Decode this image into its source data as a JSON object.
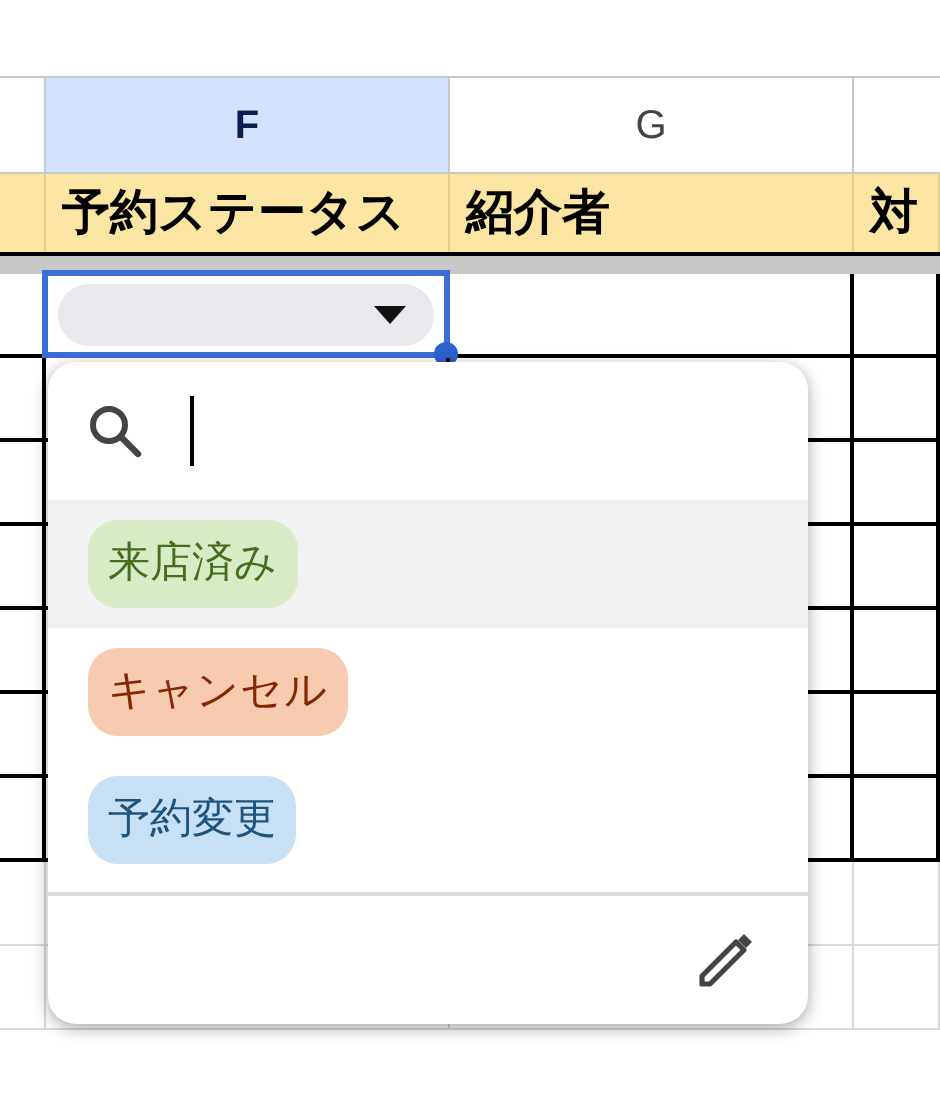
{
  "column_headers": [
    {
      "label": "F",
      "selected": true
    },
    {
      "label": "G",
      "selected": false
    }
  ],
  "header_row": [
    "予約ステータス",
    "紹介者",
    "対"
  ],
  "active_cell": {
    "kind": "dropdown-chip"
  },
  "dropdown": {
    "search": {
      "focused": true
    },
    "options": [
      {
        "label": "来店済み",
        "color": "#d9ebc6",
        "selected": true
      },
      {
        "label": "キャンセル",
        "color": "#f6cbb0",
        "selected": false
      },
      {
        "label": "予約変更",
        "color": "#c7e0f3",
        "selected": false
      }
    ]
  }
}
